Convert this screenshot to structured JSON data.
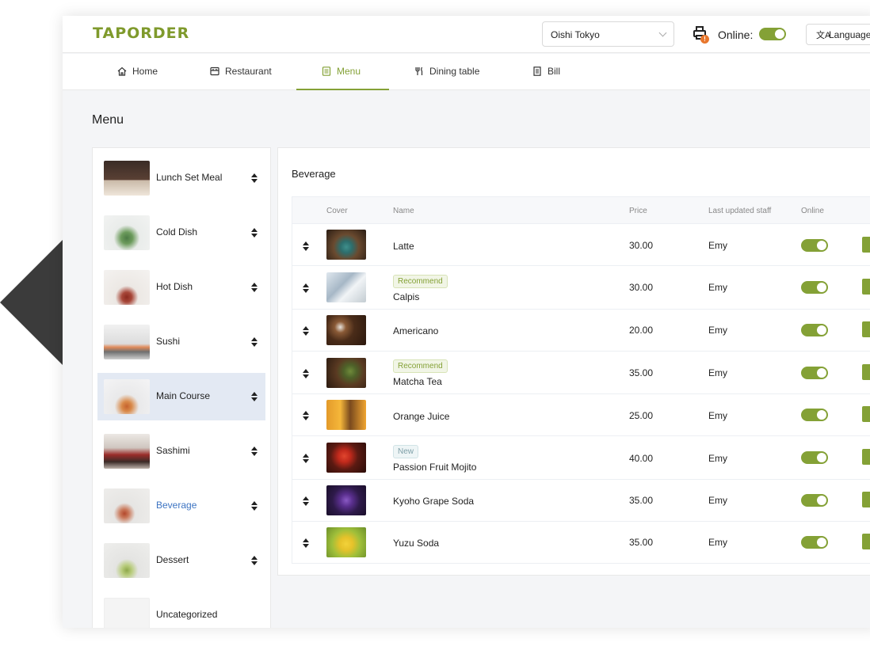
{
  "header": {
    "logo": "TAPORDER",
    "store_select": "Oishi Tokyo",
    "online_label": "Online:",
    "online": true,
    "language_label": "Language"
  },
  "nav": {
    "items": [
      {
        "label": "Home",
        "icon": "home-icon"
      },
      {
        "label": "Restaurant",
        "icon": "store-icon"
      },
      {
        "label": "Menu",
        "icon": "menu-doc-icon",
        "active": true
      },
      {
        "label": "Dining table",
        "icon": "fork-knife-icon"
      },
      {
        "label": "Bill",
        "icon": "bill-icon"
      }
    ]
  },
  "page": {
    "title": "Menu"
  },
  "categories": [
    {
      "label": "Lunch Set Meal"
    },
    {
      "label": "Cold Dish"
    },
    {
      "label": "Hot Dish"
    },
    {
      "label": "Sushi"
    },
    {
      "label": "Main Course",
      "highlighted": true
    },
    {
      "label": "Sashimi"
    },
    {
      "label": "Beverage",
      "selected": true
    },
    {
      "label": "Dessert"
    },
    {
      "label": "Uncategorized"
    }
  ],
  "main": {
    "section_title": "Beverage",
    "columns": {
      "cover": "Cover",
      "name": "Name",
      "price": "Price",
      "staff": "Last updated staff",
      "online": "Online"
    },
    "rows": [
      {
        "name": "Latte",
        "price": "30.00",
        "staff": "Emy",
        "online": true,
        "badge": ""
      },
      {
        "name": "Calpis",
        "price": "30.00",
        "staff": "Emy",
        "online": true,
        "badge": "Recommend"
      },
      {
        "name": "Americano",
        "price": "20.00",
        "staff": "Emy",
        "online": true,
        "badge": ""
      },
      {
        "name": "Matcha Tea",
        "price": "35.00",
        "staff": "Emy",
        "online": true,
        "badge": "Recommend"
      },
      {
        "name": "Orange Juice",
        "price": "25.00",
        "staff": "Emy",
        "online": true,
        "badge": ""
      },
      {
        "name": "Passion Fruit Mojito",
        "price": "40.00",
        "staff": "Emy",
        "online": true,
        "badge": "New"
      },
      {
        "name": "Kyoho Grape Soda",
        "price": "35.00",
        "staff": "Emy",
        "online": true,
        "badge": ""
      },
      {
        "name": "Yuzu Soda",
        "price": "35.00",
        "staff": "Emy",
        "online": true,
        "badge": ""
      }
    ]
  },
  "colors": {
    "accent": "#84a136",
    "logo": "#7f9a2c",
    "link": "#3d74c2",
    "selected_bg": "#e3e9f3"
  }
}
